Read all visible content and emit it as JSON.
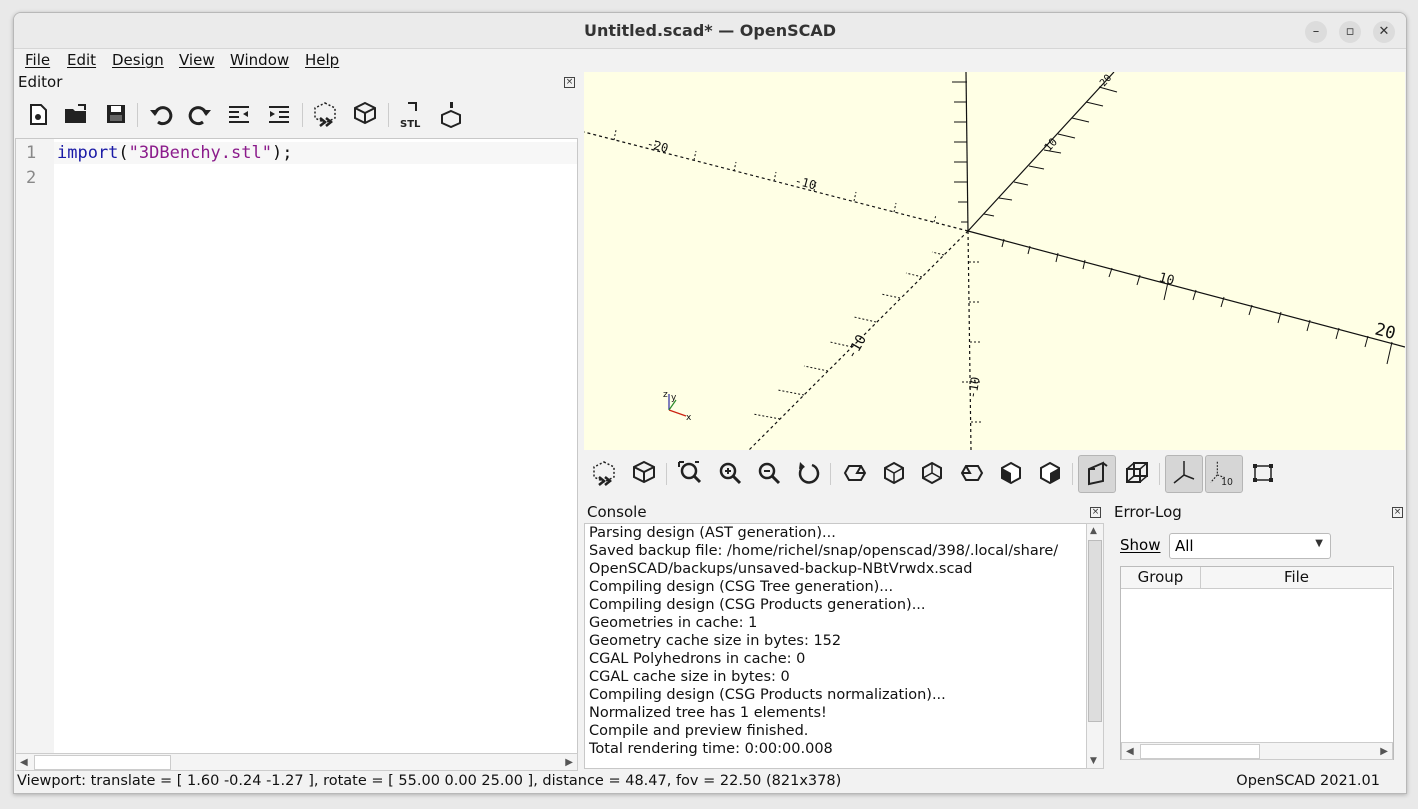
{
  "window": {
    "title": "Untitled.scad* — OpenSCAD",
    "minimize": "–",
    "maximize": "▫",
    "close": "✕"
  },
  "menu": [
    {
      "label": "File"
    },
    {
      "label": "Edit"
    },
    {
      "label": "Design"
    },
    {
      "label": "View"
    },
    {
      "label": "Window"
    },
    {
      "label": "Help"
    }
  ],
  "editor": {
    "title": "Editor",
    "lines": [
      {
        "num": "1",
        "func": "import",
        "open": "(",
        "str": "\"3DBenchy.stl\"",
        "close": ");"
      },
      {
        "num": "2",
        "func": "",
        "open": "",
        "str": "",
        "close": ""
      }
    ],
    "toolbar": [
      "new-file-icon",
      "open-file-icon",
      "save-icon",
      "undo-icon",
      "redo-icon",
      "unindent-icon",
      "indent-icon",
      "preview-icon",
      "render-icon",
      "export-stl-icon",
      "send-to-3d-print-icon"
    ]
  },
  "viewport": {
    "axis_labels": {
      "x_pos_10": "10",
      "x_pos_20": "20",
      "y_pos_10": "10",
      "y_pos_20": "20",
      "x_neg_10": "-10",
      "x_neg_20": "-20",
      "z_neg_10": "-10"
    },
    "axes_indicator": {
      "x": "x",
      "y": "y",
      "z": "z"
    },
    "toolbar": [
      "preview-icon",
      "render-icon",
      "view-all-icon",
      "zoom-in-icon",
      "zoom-out-icon",
      "reset-view-icon",
      "view-right-icon",
      "view-top-icon",
      "view-bottom-icon",
      "view-left-icon",
      "view-front-icon",
      "view-back-icon",
      "perspective-icon",
      "orthogonal-icon",
      "show-axes-icon",
      "show-scale-markers-icon",
      "show-edges-icon"
    ],
    "scale_marker_label": "10"
  },
  "console": {
    "title": "Console",
    "lines": [
      "Parsing design (AST generation)...",
      "Saved backup file: /home/richel/snap/openscad/398/.local/share/",
      "OpenSCAD/backups/unsaved-backup-NBtVrwdx.scad",
      "Compiling design (CSG Tree generation)...",
      "Compiling design (CSG Products generation)...",
      "Geometries in cache: 1",
      "Geometry cache size in bytes: 152",
      "CGAL Polyhedrons in cache: 0",
      "CGAL cache size in bytes: 0",
      "Compiling design (CSG Products normalization)...",
      "Normalized tree has 1 elements!",
      "Compile and preview finished.",
      "Total rendering time: 0:00:00.008"
    ]
  },
  "errorlog": {
    "title": "Error-Log",
    "show_label": "Show",
    "show_value": "All",
    "columns": [
      "Group",
      "File"
    ]
  },
  "status": {
    "viewport": "Viewport: translate = [ 1.60 -0.24 -1.27 ], rotate = [ 55.00 0.00 25.00 ], distance = 48.47, fov = 22.50 (821x378)",
    "version": "OpenSCAD 2021.01"
  },
  "colors": {
    "viewport_bg": "#ffffe5",
    "keyword": "#1a1aa6",
    "string": "#8b1b8b"
  }
}
